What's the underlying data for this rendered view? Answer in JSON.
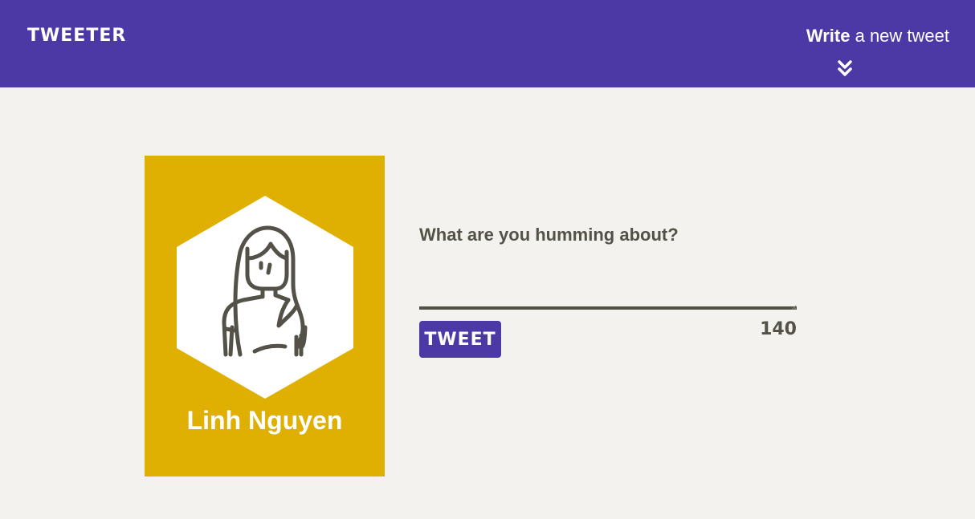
{
  "header": {
    "brand": "TWEETER",
    "compose_bold": "Write",
    "compose_rest": " a new tweet",
    "compose_icon": "double-chevron-down-icon"
  },
  "profile": {
    "name": "Linh Nguyen",
    "avatar_icon": "woman-avatar-icon",
    "card_color": "#dfb002"
  },
  "composer": {
    "placeholder": "What are you humming about?",
    "value": "",
    "submit_label": "TWEET",
    "char_count": "140"
  },
  "colors": {
    "accent": "#4c39a5",
    "background": "#f3f2ee",
    "text": "#545149"
  }
}
